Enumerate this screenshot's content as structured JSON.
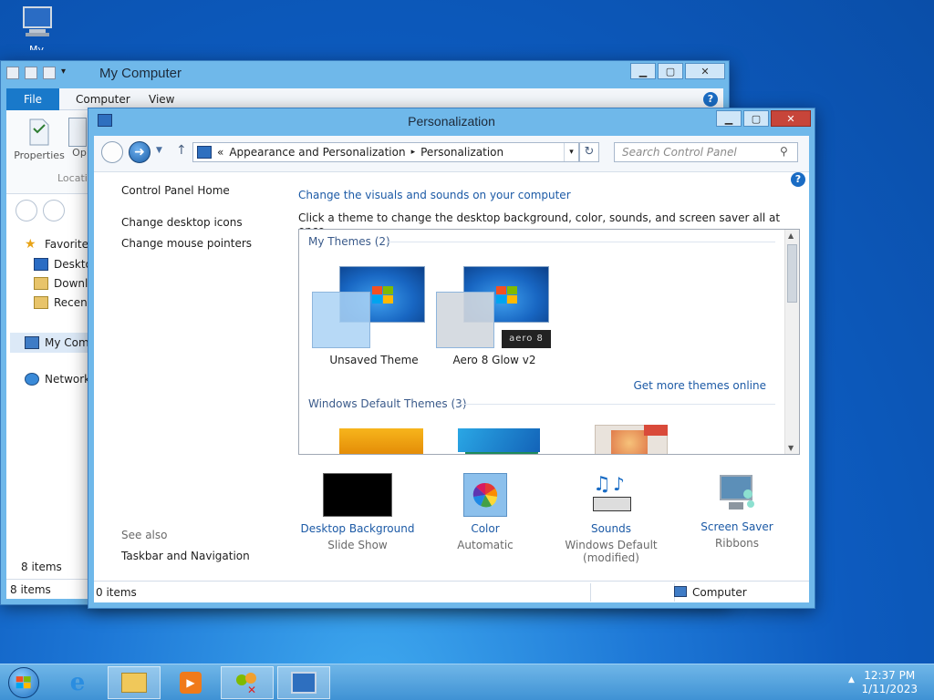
{
  "desktop": {
    "icon_label": "My Computer"
  },
  "explorer": {
    "title": "My Computer",
    "tabs": [
      "File",
      "Computer",
      "View"
    ],
    "ribbon": {
      "properties": "Properties",
      "open_partial": "Op",
      "location_partial": "Locati"
    },
    "nav": [
      "Favorites",
      "Deskto",
      "Downlo",
      "Recent",
      "My Com",
      "Network"
    ],
    "status_items": "8 items",
    "status_items_bottom": "8 items"
  },
  "personalization": {
    "title": "Personalization",
    "address": {
      "chevrons": "«",
      "seg1": "Appearance and Personalization",
      "sep": "▸",
      "seg2": "Personalization"
    },
    "search_placeholder": "Search Control Panel",
    "left": {
      "home": "Control Panel Home",
      "desktop_icons": "Change desktop icons",
      "mouse_pointers": "Change mouse pointers",
      "see_also": "See also",
      "taskbar_nav": "Taskbar and Navigation"
    },
    "heading": "Change the visuals and sounds on your computer",
    "instruction": "Click a theme to change the desktop background, color, sounds, and screen saver all at once.",
    "my_themes_label": "My Themes (2)",
    "themes": [
      "Unsaved Theme",
      "Aero 8 Glow v2"
    ],
    "badge_text": "aero 8",
    "more_themes_link": "Get more themes online",
    "default_themes_label": "Windows Default Themes (3)",
    "bottom": [
      {
        "label": "Desktop Background",
        "sub": "Slide Show"
      },
      {
        "label": "Color",
        "sub": "Automatic"
      },
      {
        "label": "Sounds",
        "sub": "Windows Default",
        "sub2": "(modified)"
      },
      {
        "label": "Screen Saver",
        "sub": "Ribbons"
      }
    ],
    "status_items": "0 items",
    "status_computer": "Computer"
  },
  "taskbar": {
    "time": "12:37 PM",
    "date": "1/11/2023"
  },
  "colors": {
    "accent": "#1979ca",
    "link": "#1c5aa6",
    "window_frame": "#6fb8ea",
    "close": "#c7453a"
  }
}
